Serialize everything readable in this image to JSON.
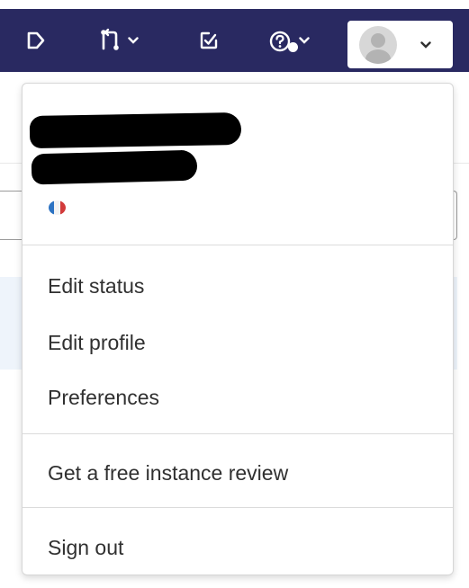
{
  "navbar": {
    "background": "#292961",
    "icons": {
      "todo": "todo-icon",
      "merge_requests": "merge-request-icon",
      "issues": "issues-icon",
      "help": "help-icon",
      "chevron": "chevron-down-icon"
    }
  },
  "user_menu": {
    "avatar": "avatar-icon",
    "name": "",
    "username": "",
    "status_emoji": "flag-icon",
    "items": [
      {
        "label": "Edit status"
      },
      {
        "label": "Edit profile"
      },
      {
        "label": "Preferences"
      },
      {
        "label": "Get a free instance review"
      },
      {
        "label": "Sign out"
      }
    ]
  }
}
